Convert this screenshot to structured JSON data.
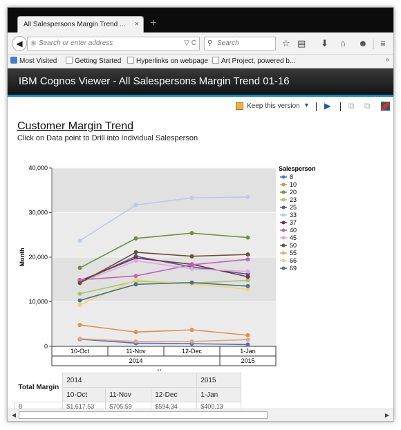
{
  "browser": {
    "tab_title": "All Salespersons Margin Trend ...",
    "tab_close": "×",
    "new_tab": "+",
    "url_placeholder": "Search or enter address",
    "search_placeholder": "Search",
    "bookmarks": [
      "Most Visited",
      "Getting Started",
      "Hyperlinks on webpage",
      "Art Project, powered b..."
    ],
    "bookmarks_more": "»"
  },
  "viewer": {
    "title": "IBM Cognos Viewer - All Salespersons Margin Trend 01-16",
    "keep_version": "Keep this version"
  },
  "report": {
    "title": "Customer Margin Trend",
    "subtitle": "Click on Data point to Drill into Individual Salesperson"
  },
  "chart_data": {
    "type": "line",
    "ylabel": "Month",
    "xlabel": "Year",
    "ylim": [
      0,
      40000
    ],
    "yticks": [
      "0",
      "10,000",
      "20,000",
      "30,000",
      "40,000"
    ],
    "categories": [
      "10-Oct",
      "11-Nov",
      "12-Dec",
      "1-Jan"
    ],
    "years": [
      {
        "label": "2014",
        "span": 3
      },
      {
        "label": "2015",
        "span": 1
      }
    ],
    "legend_title": "Salesperson",
    "legend_position": "right",
    "series": [
      {
        "name": "8",
        "color": "#5470c6",
        "values": [
          1600,
          700,
          600,
          400
        ]
      },
      {
        "name": "10",
        "color": "#e0904a",
        "values": [
          4800,
          3200,
          3700,
          2500
        ]
      },
      {
        "name": "20",
        "color": "#6f8f3f",
        "values": [
          17600,
          24200,
          25400,
          24400
        ]
      },
      {
        "name": "23",
        "color": "#a7c46a",
        "values": [
          11800,
          14600,
          14200,
          14800
        ]
      },
      {
        "name": "25",
        "color": "#505a92",
        "values": [
          14400,
          20200,
          17800,
          16200
        ]
      },
      {
        "name": "33",
        "color": "#bcc9ea",
        "values": [
          23700,
          31700,
          33300,
          33500
        ]
      },
      {
        "name": "37",
        "color": "#7a2f4d",
        "values": [
          14700,
          19800,
          18400,
          15600
        ]
      },
      {
        "name": "40",
        "color": "#c660b8",
        "values": [
          14900,
          15800,
          18300,
          19500
        ]
      },
      {
        "name": "45",
        "color": "#dba8e0",
        "values": [
          14300,
          19200,
          17400,
          16800
        ]
      },
      {
        "name": "50",
        "color": "#6b5030",
        "values": [
          14200,
          21100,
          20200,
          20600
        ]
      },
      {
        "name": "55",
        "color": "#e3a878",
        "values": [
          1700,
          1100,
          1100,
          1500
        ]
      },
      {
        "name": "66",
        "color": "#f1d27a",
        "values": [
          9300,
          14900,
          14000,
          12800
        ]
      },
      {
        "name": "69",
        "color": "#497580",
        "values": [
          10300,
          13900,
          14300,
          13500
        ]
      }
    ]
  },
  "crosstab": {
    "corner": "Total Margin",
    "years": [
      "2014",
      "2015"
    ],
    "months": [
      "10-Oct",
      "11-Nov",
      "12-Dec",
      "1-Jan"
    ],
    "row_label": "8",
    "row_values": [
      "$1,617.53",
      "$705.59",
      "$594.34",
      "$400.13"
    ]
  }
}
